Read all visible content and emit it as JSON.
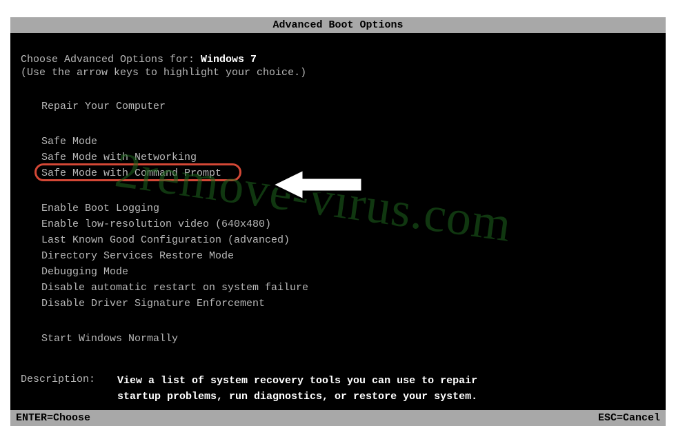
{
  "title": "Advanced Boot Options",
  "intro": {
    "prefix": "Choose Advanced Options for: ",
    "os": "Windows 7",
    "hint": "(Use the arrow keys to highlight your choice.)"
  },
  "menu": {
    "group1": [
      "Repair Your Computer"
    ],
    "group2": [
      "Safe Mode",
      "Safe Mode with Networking",
      "Safe Mode with Command Prompt"
    ],
    "group3": [
      "Enable Boot Logging",
      "Enable low-resolution video (640x480)",
      "Last Known Good Configuration (advanced)",
      "Directory Services Restore Mode",
      "Debugging Mode",
      "Disable automatic restart on system failure",
      "Disable Driver Signature Enforcement"
    ],
    "group4": [
      "Start Windows Normally"
    ],
    "highlighted_index": 2
  },
  "description": {
    "label": "Description:",
    "text_line1": "View a list of system recovery tools you can use to repair",
    "text_line2": "startup problems, run diagnostics, or restore your system."
  },
  "footer": {
    "left": "ENTER=Choose",
    "right": "ESC=Cancel"
  },
  "watermark": "2remove-virus.com"
}
